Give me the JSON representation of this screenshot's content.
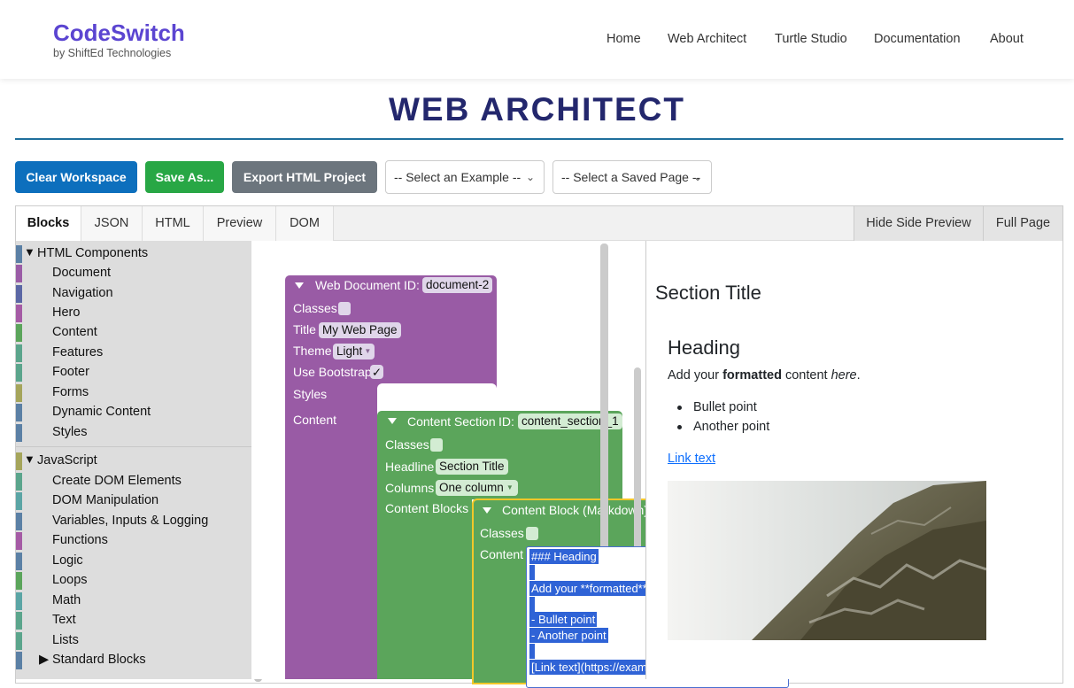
{
  "header": {
    "brand": "CodeSwitch",
    "byline": "by ShiftEd Technologies",
    "nav": [
      "Home",
      "Web Architect",
      "Turtle Studio",
      "Documentation",
      "About"
    ]
  },
  "page": {
    "title": "WEB ARCHITECT"
  },
  "toolbar": {
    "clear_label": "Clear Workspace",
    "save_label": "Save As...",
    "export_label": "Export HTML Project",
    "example_select": "-- Select an Example --",
    "saved_select": "-- Select a Saved Page --"
  },
  "tabs": {
    "left": [
      "Blocks",
      "JSON",
      "HTML",
      "Preview",
      "DOM"
    ],
    "active": "Blocks",
    "hide_preview": "Hide Side Preview",
    "full_page": "Full Page"
  },
  "toolbox": {
    "html_components": {
      "label": "HTML Components",
      "items": [
        "Document",
        "Navigation",
        "Hero",
        "Content",
        "Features",
        "Footer",
        "Forms",
        "Dynamic Content",
        "Styles"
      ]
    },
    "javascript": {
      "label": "JavaScript",
      "items": [
        "Create DOM Elements",
        "DOM Manipulation",
        "Variables, Inputs & Logging",
        "Functions",
        "Logic",
        "Loops",
        "Math",
        "Text",
        "Lists"
      ]
    },
    "standard": "Standard Blocks",
    "colors": {
      "html": [
        "#5b80a5",
        "#9a5ca6",
        "#5b67a5",
        "#a55ba5",
        "#5ba55b",
        "#5ba58c",
        "#5ba58c",
        "#a5a55b",
        "#5b80a5",
        "#5b80a5"
      ],
      "js": [
        "#a5a55b",
        "#5ba58c",
        "#5ba5a5",
        "#5b80a5",
        "#a55ba5",
        "#5b80a5",
        "#5ba55b",
        "#5ba5a5",
        "#5ba58c",
        "#5ba58c",
        "#5b80a5"
      ]
    }
  },
  "workspace": {
    "doc_block": {
      "title": "Web Document",
      "id_label": "ID:",
      "id_value": "document-2",
      "classes_label": "Classes",
      "title_label": "Title",
      "title_value": "My Web Page",
      "theme_label": "Theme",
      "theme_value": "Light",
      "bootstrap_label": "Use Bootstrap",
      "bootstrap_check": "✓",
      "styles_label": "Styles",
      "content_label": "Content",
      "color": "#995ba5"
    },
    "section_block": {
      "title": "Content Section",
      "id_label": "ID:",
      "id_value": "content_section_1",
      "classes_label": "Classes",
      "headline_label": "Headline",
      "headline_value": "Section Title",
      "columns_label": "Columns",
      "columns_value": "One column",
      "content_blocks_label": "Content Blocks",
      "color": "#5ba55b"
    },
    "md_block": {
      "title": "Content Block (Markdown)",
      "classes_label": "Classes",
      "content_label": "Content",
      "color": "#5ba55b",
      "highlight": "#f2c829"
    },
    "markdown_lines": [
      "### Heading",
      "",
      "Add your **formatted** content *here*.",
      "",
      "- Bullet point",
      "- Another point",
      "",
      "[Link text](https://example.com)"
    ]
  },
  "preview": {
    "section_title": "Section Title",
    "heading": "Heading",
    "para_pre": "Add your ",
    "para_bold": "formatted",
    "para_mid": " content ",
    "para_italic": "here",
    "para_end": ".",
    "bullets": [
      "Bullet point",
      "Another point"
    ],
    "link": "Link text"
  }
}
